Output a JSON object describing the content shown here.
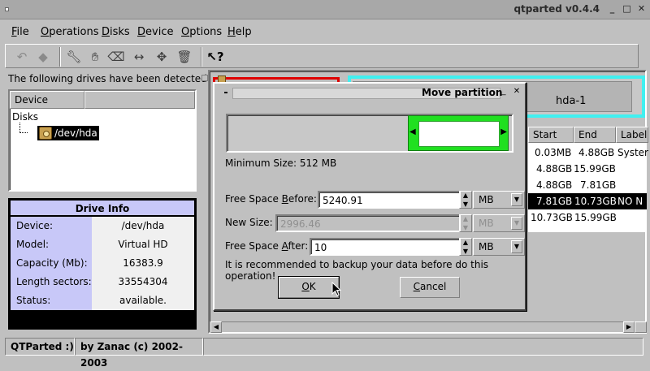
{
  "window": {
    "title": "qtparted v0.4.4"
  },
  "menu": [
    {
      "pre": "",
      "u": "F",
      "post": "ile"
    },
    {
      "pre": "",
      "u": "O",
      "post": "perations"
    },
    {
      "pre": "",
      "u": "D",
      "post": "isks"
    },
    {
      "pre": "",
      "u": "D",
      "post": "evice"
    },
    {
      "pre": "",
      "u": "O",
      "post": "ptions"
    },
    {
      "pre": "",
      "u": "H",
      "post": "elp"
    }
  ],
  "left": {
    "drives_label": "The following drives have been detected:",
    "tree_header": "Device",
    "tree_root": "Disks",
    "tree_device": "/dev/hda"
  },
  "drive_info": {
    "title": "Drive Info",
    "rows": [
      {
        "key": "Device:",
        "value": "/dev/hda"
      },
      {
        "key": "Model:",
        "value": "Virtual HD"
      },
      {
        "key": "Capacity (Mb):",
        "value": "16383.9"
      },
      {
        "key": "Length sectors:",
        "value": "33554304"
      },
      {
        "key": "Status:",
        "value": "available."
      }
    ]
  },
  "partition_map": {
    "label": "hda-1"
  },
  "partition_table": {
    "headers": [
      "Start",
      "End",
      "Label"
    ],
    "rows": [
      {
        "start": "0.03MB",
        "end": "4.88GB",
        "label": "Syster"
      },
      {
        "start": "4.88GB",
        "end": "15.99GB",
        "label": ""
      },
      {
        "start": "4.88GB",
        "end": "7.81GB",
        "label": ""
      },
      {
        "start": "7.81GB",
        "end": "10.73GB",
        "label": "NO N"
      },
      {
        "start": "10.73GB",
        "end": "15.99GB",
        "label": ""
      }
    ]
  },
  "status": {
    "left": "QTParted :)",
    "right": "by Zanac (c) 2002-2003"
  },
  "dialog": {
    "title": "Move partition",
    "min_size": "Minimum Size: 512 MB",
    "free_before": {
      "pre": "Free Space ",
      "u": "B",
      "post": "efore:",
      "value": "5240.91",
      "unit": "MB"
    },
    "new_size": {
      "label": "New Size:",
      "value": "2996.46",
      "unit": "MB"
    },
    "free_after": {
      "pre": "Free Space ",
      "u": "A",
      "post": "fter:",
      "value": "10",
      "unit": "MB"
    },
    "warning": "It is recommended to backup your data before do this operation!",
    "ok": {
      "pre": "",
      "u": "O",
      "post": "K"
    },
    "cancel": {
      "pre": "",
      "u": "C",
      "post": "ancel"
    }
  },
  "icons": {
    "toolbar": [
      "undo-icon",
      "redo-icon",
      "wrench-icon",
      "hand-icon",
      "eraser-icon",
      "resize-icon",
      "move-icon",
      "trash-icon",
      "whats-this-icon"
    ]
  },
  "colors": {
    "selected_partition_border": "#e00000",
    "extended_partition_border": "#40f0f0",
    "preview_partition": "#20e020",
    "drive_info_header": "#c8c8f8"
  }
}
